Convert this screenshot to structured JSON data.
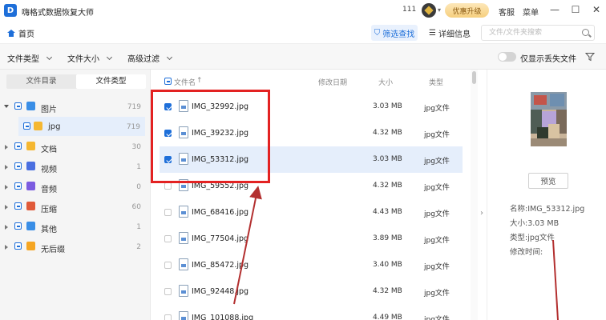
{
  "app": {
    "logo_letter": "D",
    "title": "嗨格式数据恢复大师",
    "count": "111",
    "vip_label": "优惠升级",
    "service_label": "客服",
    "menu_label": "菜单"
  },
  "nav": {
    "home_label": "首页",
    "filter_label": "筛选查找",
    "detail_label": "详细信息",
    "search_placeholder": "文件/文件夹搜索"
  },
  "filters": {
    "file_type": "文件类型",
    "file_size": "文件大小",
    "advanced": "高级过滤",
    "toggle_label": "仅显示丢失文件"
  },
  "sidebar": {
    "tabs": [
      "文件目录",
      "文件类型"
    ],
    "active_tab": 1,
    "items": [
      {
        "label": "图片",
        "count": "719",
        "color": "#3a8ee6",
        "expanded": true
      },
      {
        "label": "jpg",
        "count": "719",
        "color": "#f5b731",
        "child": true
      },
      {
        "label": "文档",
        "count": "30",
        "color": "#f5b731"
      },
      {
        "label": "视频",
        "count": "1",
        "color": "#4a6fe0"
      },
      {
        "label": "音频",
        "count": "0",
        "color": "#7b5ce0"
      },
      {
        "label": "压缩",
        "count": "60",
        "color": "#e05a3a"
      },
      {
        "label": "其他",
        "count": "1",
        "color": "#3a8ee6"
      },
      {
        "label": "无后缀",
        "count": "2",
        "color": "#f5a623"
      }
    ]
  },
  "list": {
    "headers": {
      "name": "文件名",
      "modified": "修改日期",
      "size": "大小",
      "type": "类型"
    },
    "rows": [
      {
        "name": "IMG_32992.jpg",
        "size": "3.03 MB",
        "type": "jpg文件",
        "checked": true
      },
      {
        "name": "IMG_39232.jpg",
        "size": "4.32 MB",
        "type": "jpg文件",
        "checked": true
      },
      {
        "name": "IMG_53312.jpg",
        "size": "3.03 MB",
        "type": "jpg文件",
        "checked": true,
        "selected": true
      },
      {
        "name": "IMG_59552.jpg",
        "size": "4.32 MB",
        "type": "jpg文件"
      },
      {
        "name": "IMG_68416.jpg",
        "size": "4.43 MB",
        "type": "jpg文件"
      },
      {
        "name": "IMG_77504.jpg",
        "size": "3.89 MB",
        "type": "jpg文件"
      },
      {
        "name": "IMG_85472.jpg",
        "size": "3.40 MB",
        "type": "jpg文件"
      },
      {
        "name": "IMG_92448.jpg",
        "size": "4.32 MB",
        "type": "jpg文件"
      },
      {
        "name": "IMG_101088.jpg",
        "size": "4.49 MB",
        "type": "jpg文件"
      }
    ]
  },
  "preview": {
    "button_label": "预览",
    "name_line": "名称:IMG_53312.jpg",
    "size_line": "大小:3.03 MB",
    "type_line": "类型:jpg文件",
    "modified_line": "修改时间:"
  },
  "colors": {
    "accent": "#1e6fd9",
    "annotation": "#e32222",
    "selected_bg": "#e5eefb"
  }
}
